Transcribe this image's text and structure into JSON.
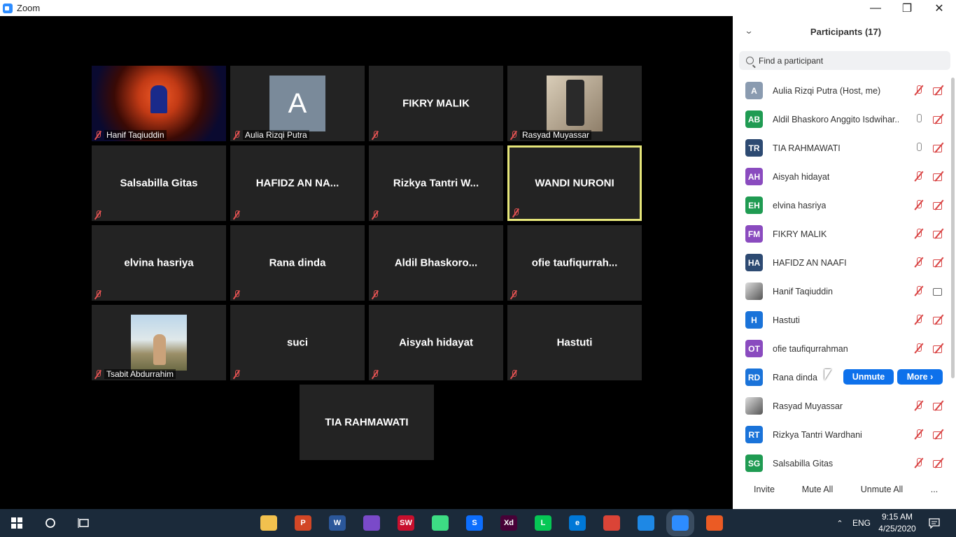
{
  "window": {
    "title": "Zoom"
  },
  "gallery": {
    "tiles": [
      {
        "name": "Hanif Taqiuddin",
        "label": "Hanif Taqiuddin",
        "kind": "photo-concert"
      },
      {
        "name": "Aulia Rizqi Putra",
        "label": "Aulia Rizqi Putra",
        "kind": "avatar",
        "avatar": "A"
      },
      {
        "name": "FIKRY MALIK",
        "label": "",
        "kind": "name"
      },
      {
        "name": "Rasyad Muyassar",
        "label": "Rasyad Muyassar",
        "kind": "photo-phone"
      },
      {
        "name": "Salsabilla Gitas",
        "label": "",
        "kind": "name"
      },
      {
        "name": "HAFIDZ AN NA...",
        "label": "",
        "kind": "name"
      },
      {
        "name": "Rizkya Tantri W...",
        "label": "",
        "kind": "name"
      },
      {
        "name": "WANDI NURONI",
        "label": "",
        "kind": "name",
        "active": true
      },
      {
        "name": "elvina hasriya",
        "label": "",
        "kind": "name"
      },
      {
        "name": "Rana dinda",
        "label": "",
        "kind": "name"
      },
      {
        "name": "Aldil  Bhaskoro...",
        "label": "",
        "kind": "name"
      },
      {
        "name": "ofie  taufiqurrah...",
        "label": "",
        "kind": "name"
      },
      {
        "name": "Tsabit Abdurrahim",
        "label": "Tsabit Abdurrahim",
        "kind": "photo-outdoor"
      },
      {
        "name": "suci",
        "label": "",
        "kind": "name"
      },
      {
        "name": "Aisyah hidayat",
        "label": "",
        "kind": "name"
      },
      {
        "name": "Hastuti",
        "label": "",
        "kind": "name"
      },
      {
        "name": "TIA RAHMAWATI",
        "label": "",
        "kind": "name",
        "nomute": true
      }
    ]
  },
  "participants": {
    "title": "Participants (17)",
    "search_placeholder": "Find a participant",
    "list": [
      {
        "initials": "A",
        "color": "#8a9bb0",
        "name": "Aulia Rizqi Putra (Host, me)",
        "mic": "off",
        "video": "off"
      },
      {
        "initials": "AB",
        "color": "#1f9b52",
        "name": "Aldil Bhaskoro Anggito Isdwihar...",
        "mic": "on",
        "video": "off"
      },
      {
        "initials": "TR",
        "color": "#2d4a72",
        "name": "TIA RAHMAWATI",
        "mic": "on",
        "video": "off"
      },
      {
        "initials": "AH",
        "color": "#8a4bbf",
        "name": "Aisyah hidayat",
        "mic": "off",
        "video": "off"
      },
      {
        "initials": "EH",
        "color": "#1f9b52",
        "name": "elvina hasriya",
        "mic": "off",
        "video": "off"
      },
      {
        "initials": "FM",
        "color": "#8a4bbf",
        "name": "FIKRY MALIK",
        "mic": "off",
        "video": "off"
      },
      {
        "initials": "HA",
        "color": "#2d4a72",
        "name": "HAFIDZ AN NAAFI",
        "mic": "off",
        "video": "off"
      },
      {
        "initials": "",
        "color": "image",
        "name": "Hanif Taqiuddin",
        "mic": "off",
        "video": "on"
      },
      {
        "initials": "H",
        "color": "#1a73d9",
        "name": "Hastuti",
        "mic": "off",
        "video": "off"
      },
      {
        "initials": "OT",
        "color": "#8a4bbf",
        "name": "ofie taufiqurrahman",
        "mic": "off",
        "video": "off"
      },
      {
        "initials": "RD",
        "color": "#1a73d9",
        "name": "Rana dinda",
        "mic": "hover",
        "video": "hover"
      },
      {
        "initials": "",
        "color": "image",
        "name": "Rasyad Muyassar",
        "mic": "off",
        "video": "off"
      },
      {
        "initials": "RT",
        "color": "#1a73d9",
        "name": "Rizkya Tantri Wardhani",
        "mic": "off",
        "video": "off"
      },
      {
        "initials": "SG",
        "color": "#1f9b52",
        "name": "Salsabilla Gitas",
        "mic": "off",
        "video": "off"
      }
    ],
    "unmute_label": "Unmute",
    "more_label": "More ›",
    "footer": {
      "invite": "Invite",
      "mute_all": "Mute All",
      "unmute_all": "Unmute All",
      "more": "..."
    }
  },
  "taskbar": {
    "apps": [
      {
        "icon": "file-explorer-icon",
        "color": "#f2c14e",
        "text": ""
      },
      {
        "icon": "powerpoint-icon",
        "color": "#d24726",
        "text": "P"
      },
      {
        "icon": "word-icon",
        "color": "#2b579a",
        "text": "W"
      },
      {
        "icon": "creative-app-icon",
        "color": "#7a4ac9",
        "text": ""
      },
      {
        "icon": "solidworks-icon",
        "color": "#c8102e",
        "text": "SW"
      },
      {
        "icon": "android-studio-icon",
        "color": "#3ddc84",
        "text": ""
      },
      {
        "icon": "sketchup-icon",
        "color": "#0d6efd",
        "text": "S"
      },
      {
        "icon": "adobe-xd-icon",
        "color": "#470137",
        "text": "Xd"
      },
      {
        "icon": "line-icon",
        "color": "#06c755",
        "text": "L"
      },
      {
        "icon": "edge-icon",
        "color": "#0078d7",
        "text": "e"
      },
      {
        "icon": "chrome-icon",
        "color": "#db4437",
        "text": ""
      },
      {
        "icon": "photos-icon",
        "color": "#1e88e5",
        "text": ""
      },
      {
        "icon": "zoom-icon",
        "color": "#2d8cff",
        "text": ""
      },
      {
        "icon": "office-icon",
        "color": "#eb5b24",
        "text": ""
      }
    ],
    "language": "ENG",
    "time": "9:15 AM",
    "date": "4/25/2020"
  }
}
